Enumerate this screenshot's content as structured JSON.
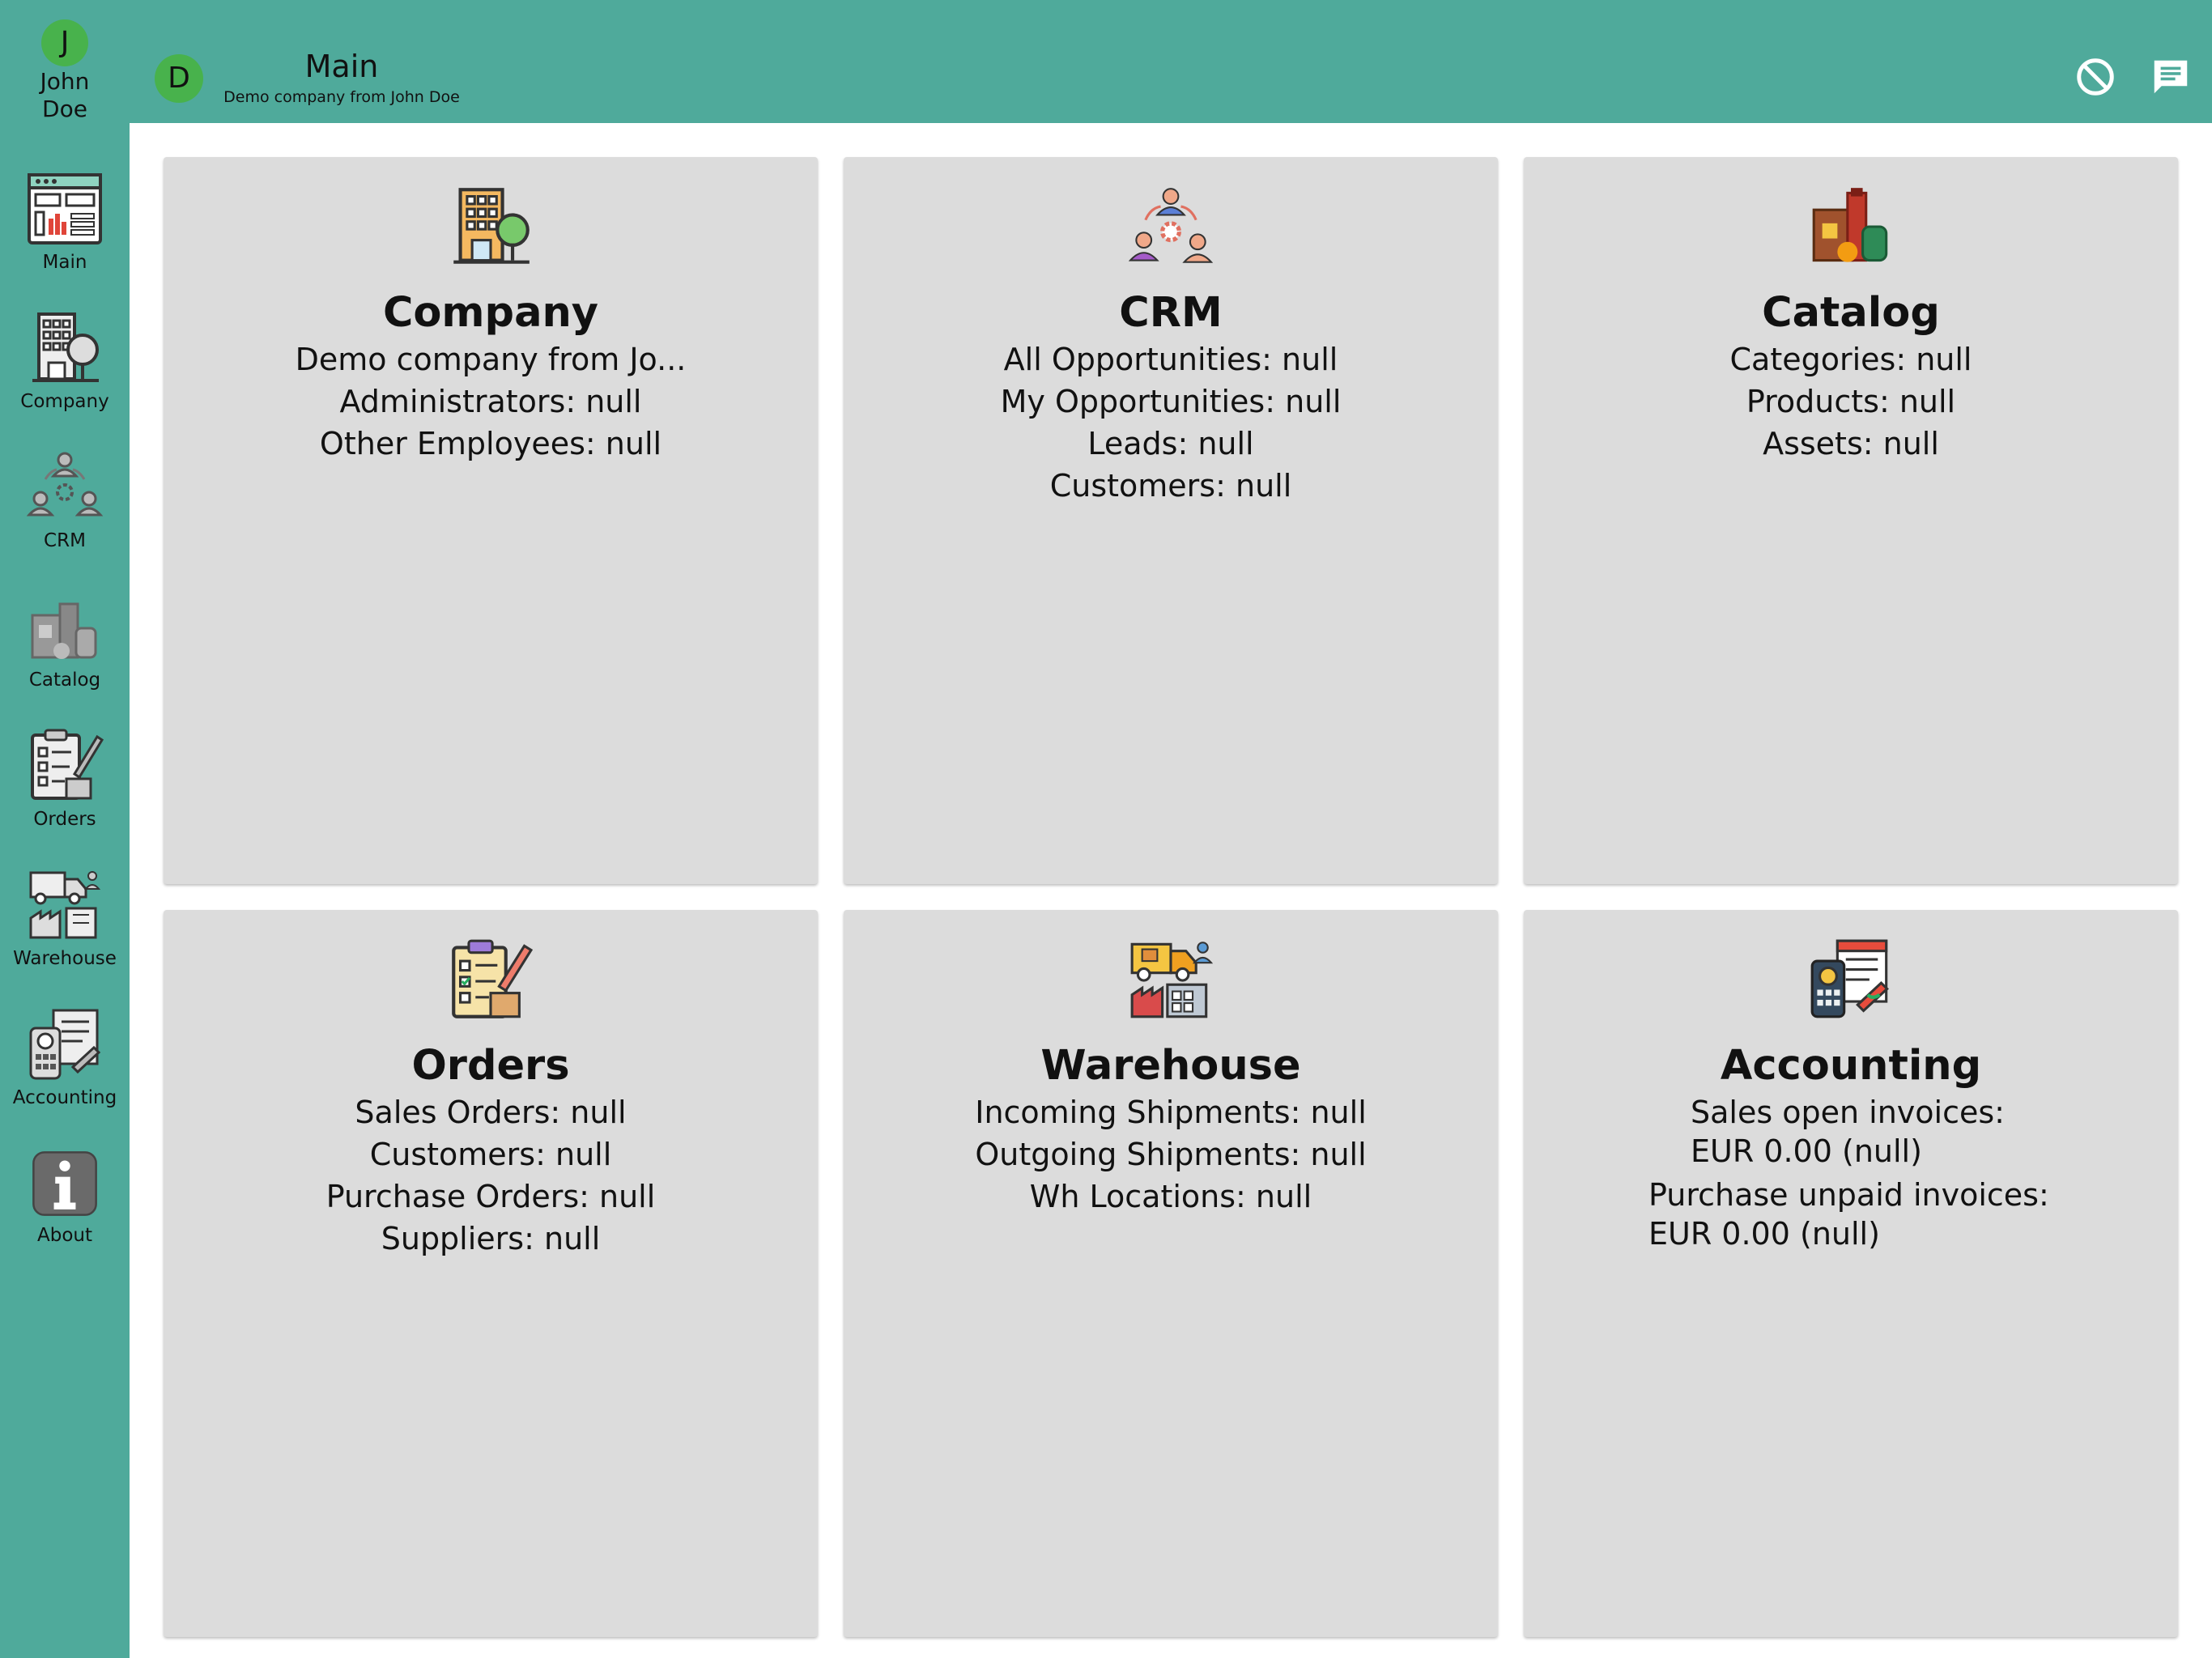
{
  "header": {
    "user_initial": "J",
    "user_name": "John Doe",
    "company_initial": "D",
    "title": "Main",
    "subtitle": "Demo company from John Doe",
    "actions": [
      "block-icon",
      "chat-icon"
    ]
  },
  "sidebar": {
    "items": [
      {
        "label": "Main",
        "icon": "dashboard-icon"
      },
      {
        "label": "Company",
        "icon": "building-icon"
      },
      {
        "label": "CRM",
        "icon": "people-network-icon"
      },
      {
        "label": "Catalog",
        "icon": "products-icon"
      },
      {
        "label": "Orders",
        "icon": "clipboard-pencil-icon"
      },
      {
        "label": "Warehouse",
        "icon": "truck-factory-icon"
      },
      {
        "label": "Accounting",
        "icon": "calculator-invoice-icon"
      },
      {
        "label": "About",
        "icon": "info-icon"
      }
    ]
  },
  "cards": {
    "company": {
      "title": "Company",
      "lines": [
        "Demo company from Jo...",
        "Administrators: null",
        "Other Employees: null"
      ]
    },
    "crm": {
      "title": "CRM",
      "lines": [
        "All Opportunities: null",
        "My Opportunities: null",
        "Leads: null",
        "Customers: null"
      ]
    },
    "catalog": {
      "title": "Catalog",
      "lines": [
        "Categories: null",
        "Products: null",
        "Assets: null"
      ]
    },
    "orders": {
      "title": "Orders",
      "lines": [
        "Sales Orders: null",
        "Customers: null",
        "Purchase Orders: null",
        "Suppliers: null"
      ]
    },
    "warehouse": {
      "title": "Warehouse",
      "lines": [
        "Incoming Shipments: null",
        "Outgoing Shipments: null",
        "Wh Locations: null"
      ]
    },
    "accounting": {
      "title": "Accounting",
      "lines": [
        "Sales open invoices:",
        "EUR 0.00 (null)",
        "Purchase unpaid invoices:",
        "EUR 0.00 (null)"
      ]
    }
  },
  "colors": {
    "bar": "#4faa9b",
    "avatar": "#48b24c",
    "card": "#dcdcdc"
  }
}
